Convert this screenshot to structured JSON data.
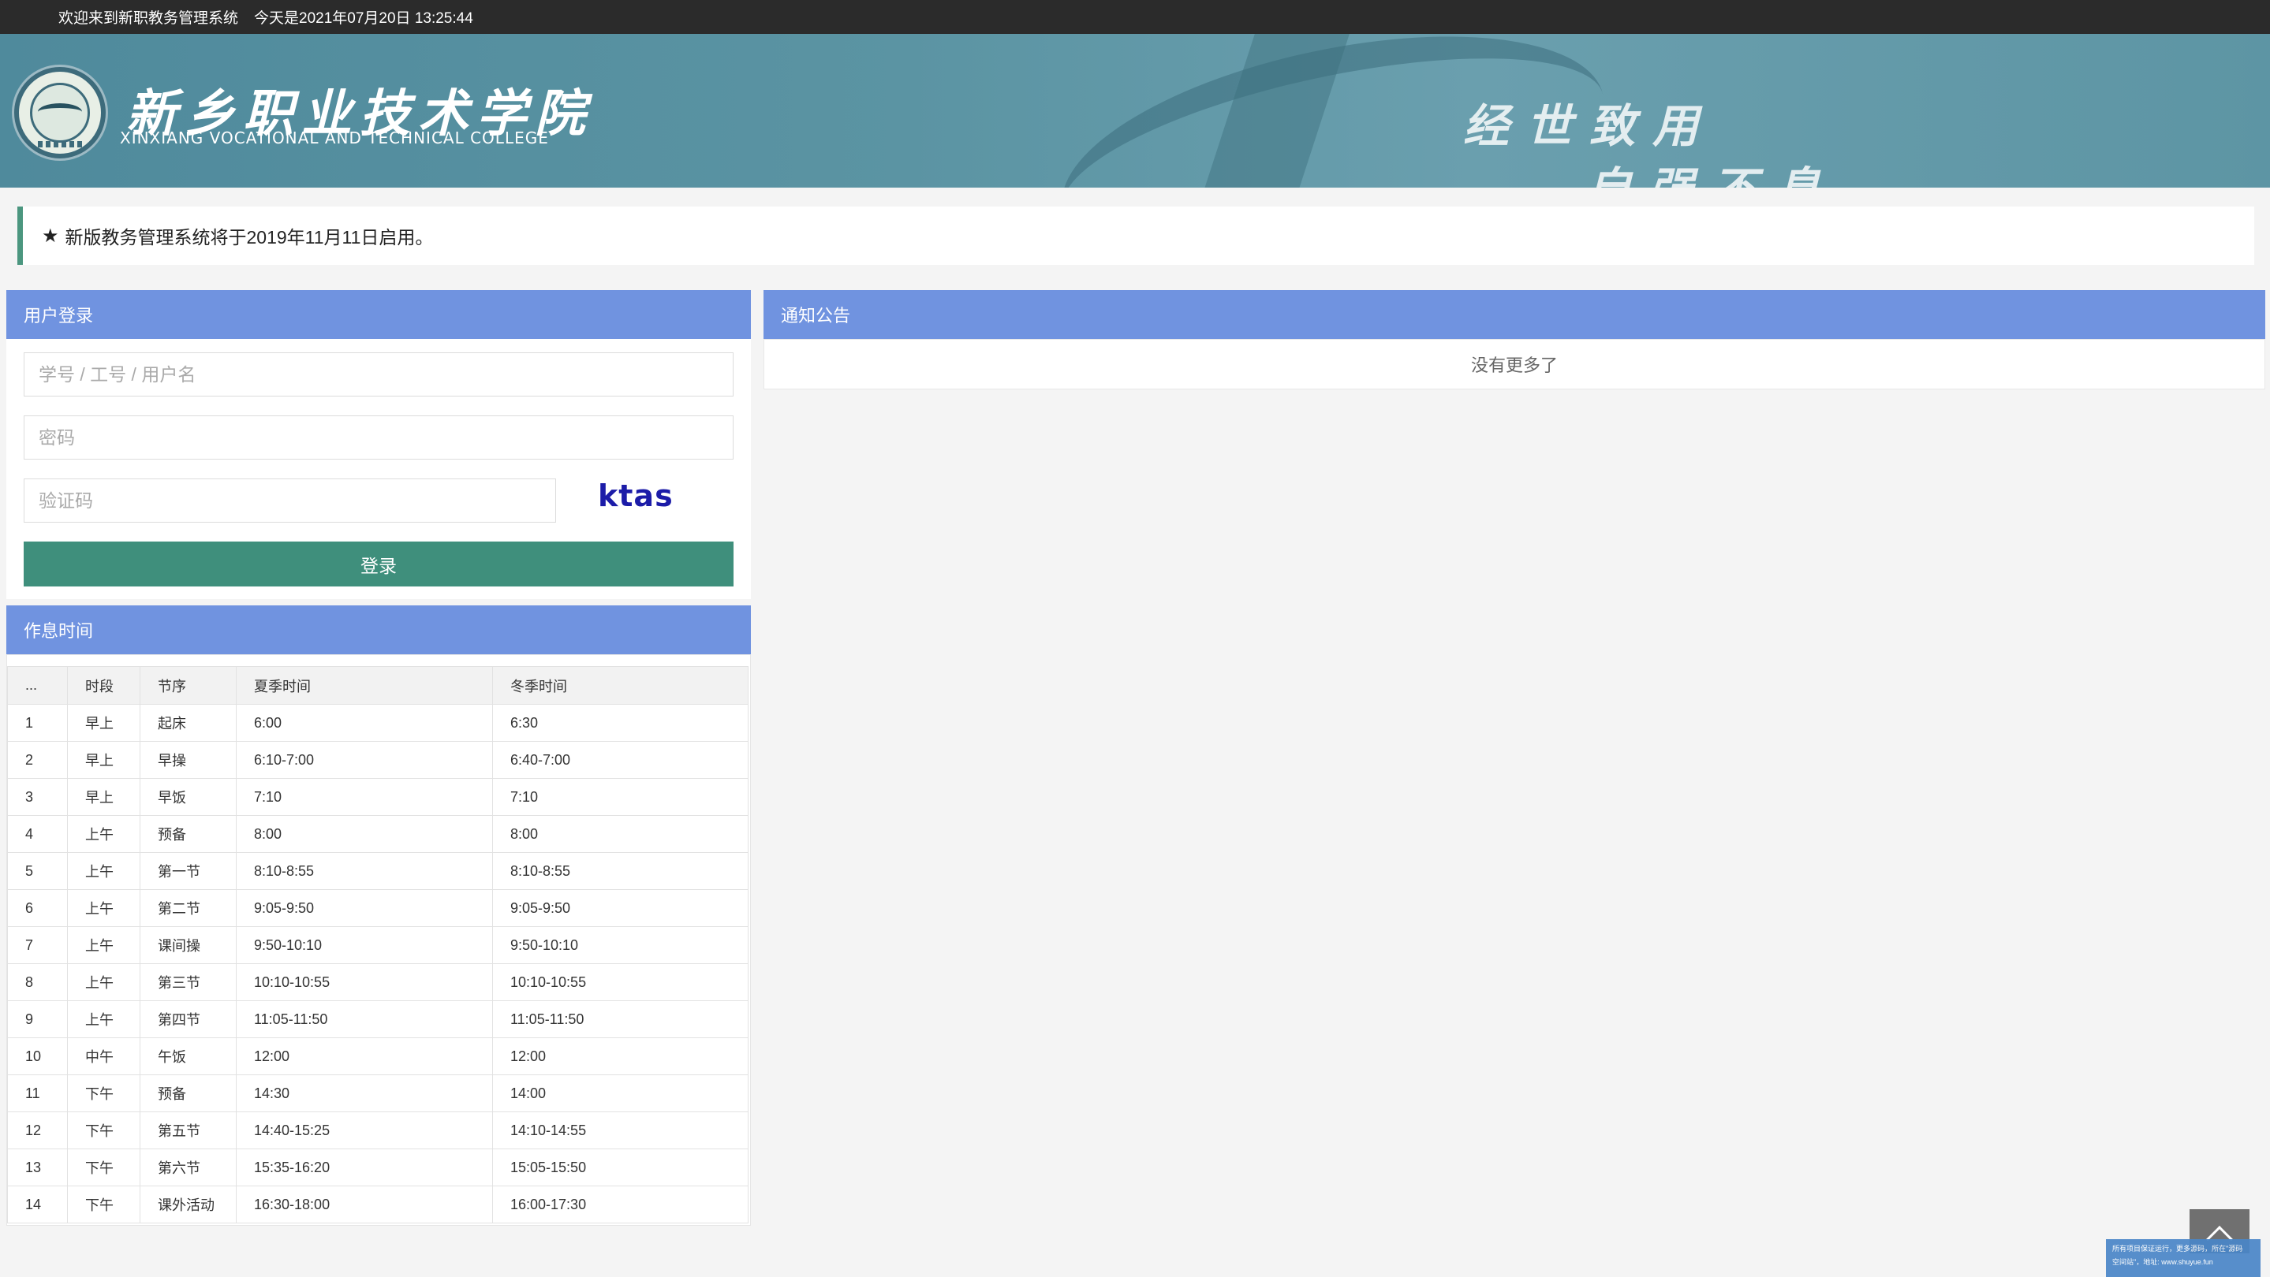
{
  "topbar": {
    "welcome": "欢迎来到新职教务管理系统",
    "date_text": "今天是2021年07月20日 13:25:44"
  },
  "banner": {
    "college_cn": "新乡职业技术学院",
    "college_en": "XINXIANG VOCATIONAL AND TECHNICAL COLLEGE",
    "motto_line1": "经世致用",
    "motto_line2": "自强不息"
  },
  "notice": {
    "icon": "star-icon",
    "text": "新版教务管理系统将于2019年11月11日启用。"
  },
  "login": {
    "title": "用户登录",
    "username_placeholder": "学号 / 工号 / 用户名",
    "password_placeholder": "密码",
    "captcha_placeholder": "验证码",
    "captcha_text": "ktas",
    "submit_label": "登录"
  },
  "announcements": {
    "title": "通知公告",
    "empty_text": "没有更多了"
  },
  "schedule": {
    "title": "作息时间",
    "headers": [
      "...",
      "时段",
      "节序",
      "夏季时间",
      "冬季时间"
    ],
    "rows": [
      [
        "1",
        "早上",
        "起床",
        "6:00",
        "6:30"
      ],
      [
        "2",
        "早上",
        "早操",
        "6:10-7:00",
        "6:40-7:00"
      ],
      [
        "3",
        "早上",
        "早饭",
        "7:10",
        "7:10"
      ],
      [
        "4",
        "上午",
        "预备",
        "8:00",
        "8:00"
      ],
      [
        "5",
        "上午",
        "第一节",
        "8:10-8:55",
        "8:10-8:55"
      ],
      [
        "6",
        "上午",
        "第二节",
        "9:05-9:50",
        "9:05-9:50"
      ],
      [
        "7",
        "上午",
        "课间操",
        "9:50-10:10",
        "9:50-10:10"
      ],
      [
        "8",
        "上午",
        "第三节",
        "10:10-10:55",
        "10:10-10:55"
      ],
      [
        "9",
        "上午",
        "第四节",
        "11:05-11:50",
        "11:05-11:50"
      ],
      [
        "10",
        "中午",
        "午饭",
        "12:00",
        "12:00"
      ],
      [
        "11",
        "下午",
        "预备",
        "14:30",
        "14:00"
      ],
      [
        "12",
        "下午",
        "第五节",
        "14:40-15:25",
        "14:10-14:55"
      ],
      [
        "13",
        "下午",
        "第六节",
        "15:35-16:20",
        "15:05-15:50"
      ],
      [
        "14",
        "下午",
        "课外活动",
        "16:30-18:00",
        "16:00-17:30"
      ]
    ]
  },
  "footer": {
    "back_to_top_icon": "chevron-up-icon",
    "corner_note_line1": "所有项目保证运行，更多源码，所在\"源码",
    "corner_note_line2": "空间站\"，地址: www.shuyue.fun"
  },
  "colors": {
    "panel_header": "#7093e0",
    "login_button": "#3f8f7c",
    "notice_accent": "#4b967f",
    "topbar": "#2b2b2b"
  }
}
